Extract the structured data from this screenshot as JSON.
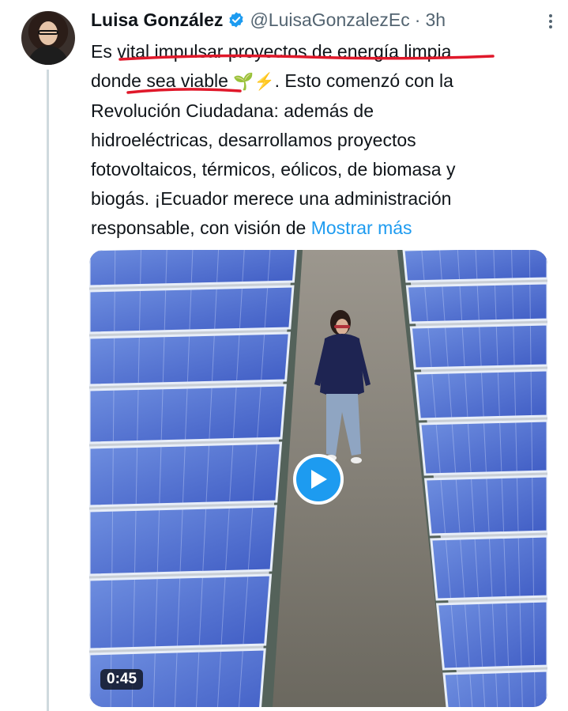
{
  "tweet": {
    "author_name": "Luisa González",
    "handle": "@LuisaGonzalezEc",
    "separator": "·",
    "time": "3h",
    "text_lines": [
      "Es vital impulsar proyectos de energía limpia",
      "donde sea viable",
      ". Esto comenzó con la",
      "Revolución Ciudadana: además de",
      "hidroeléctricas, desarrollamos proyectos",
      "fotovoltaicos, térmicos, eólicos, de biomasa y",
      "biogás. ¡Ecuador merece una administración",
      "responsable, con visión de"
    ],
    "emojis": [
      "🌱",
      "⚡"
    ],
    "show_more": "Mostrar más",
    "video_duration": "0:45"
  },
  "icons": {
    "verified": "verified-badge-icon",
    "more": "more-options-icon",
    "play": "play-icon"
  },
  "colors": {
    "verified": "#1d9bf0",
    "link": "#1d9bf0",
    "underline": "#e0182a"
  }
}
